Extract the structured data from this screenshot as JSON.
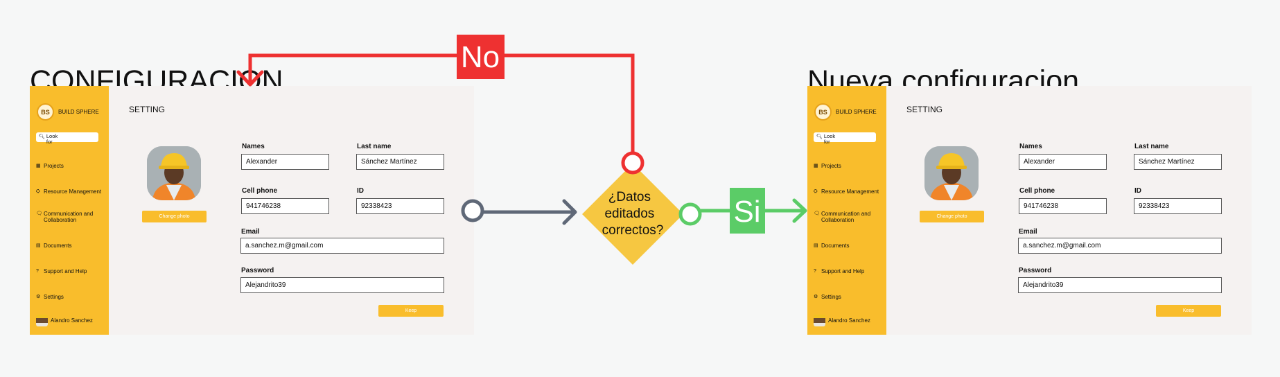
{
  "titles": {
    "left": "CONFIGURACION",
    "right": "Nueva configuracion"
  },
  "app": {
    "brand": "BUILD SPHERE",
    "logo_text": "BS",
    "search_icon": "magnifier-icon",
    "search_text": "Look for",
    "nav": [
      {
        "icon": "grid-icon",
        "glyph": "▦",
        "label": "Projects"
      },
      {
        "icon": "resource-icon",
        "glyph": "⛭",
        "label": "Resource Management"
      },
      {
        "icon": "chat-icon",
        "glyph": "🗨",
        "label": "Communication and Collaboration"
      },
      {
        "icon": "document-icon",
        "glyph": "▤",
        "label": "Documents"
      },
      {
        "icon": "help-icon",
        "glyph": "?",
        "label": "Support and Help"
      },
      {
        "icon": "gear-icon",
        "glyph": "⚙",
        "label": "Settings"
      }
    ],
    "user_name": "Alandro Sanchez",
    "page_title": "SETTING",
    "change_photo": "Change photo",
    "fields": {
      "names_label": "Names",
      "names_value": "Alexander",
      "lastname_label": "Last name",
      "lastname_value": "Sánchez Martínez",
      "phone_label": "Cell phone",
      "phone_value": "941746238",
      "id_label": "ID",
      "id_value": "92338423",
      "email_label": "Email",
      "email_value": "a.sanchez.m@gmail.com",
      "password_label": "Password",
      "password_value": "Alejandrito39"
    },
    "keep": "Keep"
  },
  "flow": {
    "decision": [
      "¿Datos",
      "editados",
      "correctos?"
    ],
    "no_label": "No",
    "yes_label": "Si",
    "colors": {
      "no": "#ee3131",
      "yes": "#5bcc67",
      "decision": "#f6c741",
      "input": "#5f6877"
    }
  }
}
